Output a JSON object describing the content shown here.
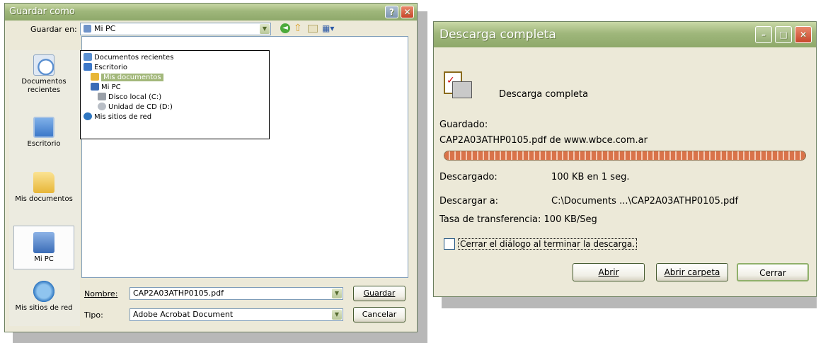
{
  "save_dialog": {
    "title": "Guardar como",
    "save_in_label": "Guardar en:",
    "save_in_value": "Mi PC",
    "places": [
      {
        "label": "Documentos recientes",
        "icon": "recent-documents-icon"
      },
      {
        "label": "Escritorio",
        "icon": "desktop-icon"
      },
      {
        "label": "Mis documentos",
        "icon": "my-documents-icon"
      },
      {
        "label": "Mi PC",
        "icon": "my-computer-icon"
      },
      {
        "label": "Mis sitios de red",
        "icon": "network-places-icon"
      }
    ],
    "dropdown_items": [
      {
        "label": "Documentos recientes",
        "icon": "recent-documents-icon"
      },
      {
        "label": "Escritorio",
        "icon": "desktop-icon"
      },
      {
        "label": "Mis documentos",
        "icon": "my-documents-icon",
        "selected": true
      },
      {
        "label": "Mi PC",
        "icon": "my-computer-icon"
      },
      {
        "label": "Disco local (C:)",
        "icon": "local-disk-icon"
      },
      {
        "label": "Unidad de CD (D:)",
        "icon": "cd-drive-icon"
      },
      {
        "label": "Mis sitios de red",
        "icon": "network-places-icon"
      }
    ],
    "filename_label": "Nombre:",
    "filename_value": "CAP2A03ATHP0105.pdf",
    "filetype_label": "Tipo:",
    "filetype_value": "Adobe Acrobat Document",
    "save_button": "Guardar",
    "cancel_button": "Cancelar"
  },
  "download_dialog": {
    "title": "Descarga completa",
    "heading": "Descarga completa",
    "saved_label": "Guardado:",
    "saved_file": "CAP2A03ATHP0105.pdf de www.wbce.com.ar",
    "progress": 1.0,
    "downloaded_label": "Descargado:",
    "downloaded_value": "100 KB en 1 seg.",
    "download_to_label": "Descargar a:",
    "download_to_value": "C:\\Documents ...\\CAP2A03ATHP0105.pdf",
    "rate_text": "Tasa de transferencia: 100 KB/Seg",
    "close_checkbox_label": "Cerrar el diálogo al terminar la descarga.",
    "close_checkbox_checked": false,
    "open_button": "Abrir",
    "open_folder_button": "Abrir carpeta",
    "close_button": "Cerrar"
  },
  "colors": {
    "title_bar": "#9fb77b",
    "progress_fill": "#d9734a",
    "selection": "#a3b87b"
  }
}
